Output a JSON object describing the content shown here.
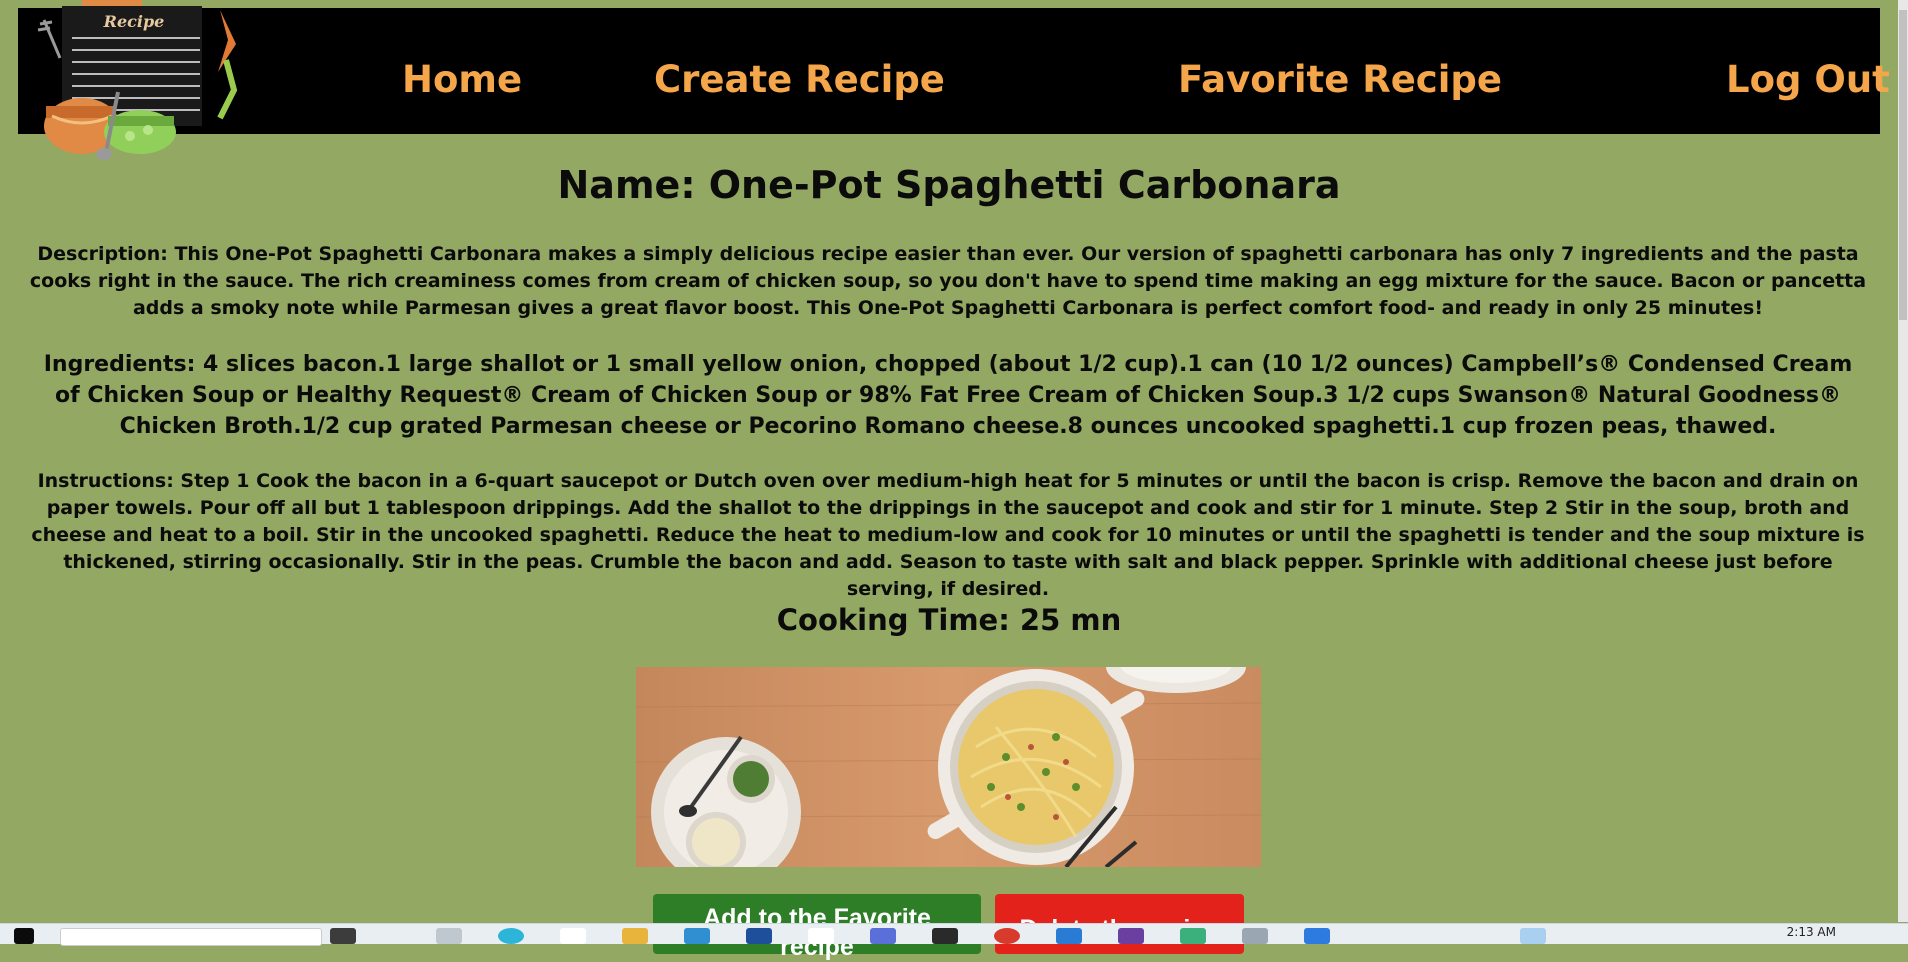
{
  "nav": {
    "logo_text": "Recipe",
    "home": "Home",
    "create": "Create Recipe",
    "favorite": "Favorite Recipe",
    "logout": "Log Out"
  },
  "recipe": {
    "name": "Name: One-Pot Spaghetti Carbonara",
    "description": "Description: This One-Pot Spaghetti Carbonara makes a simply delicious recipe easier than ever. Our version of spaghetti carbonara has only 7 ingredients and the pasta cooks right in the sauce. The rich creaminess comes from cream of chicken soup, so you don't have to spend time making an egg mixture for the sauce. Bacon or pancetta adds a smoky note while Parmesan gives a great flavor boost. This One-Pot Spaghetti Carbonara is perfect comfort food- and ready in only 25 minutes!",
    "ingredients": "Ingredients: 4 slices bacon.1 large shallot or 1 small yellow onion, chopped (about 1/2 cup).1 can (10 1/2 ounces) Campbell’s® Condensed Cream of Chicken Soup or Healthy Request® Cream of Chicken Soup or 98% Fat Free Cream of Chicken Soup.3 1/2 cups Swanson® Natural Goodness® Chicken Broth.1/2 cup grated Parmesan cheese or Pecorino Romano cheese.8 ounces uncooked spaghetti.1 cup frozen peas, thawed.",
    "instructions": "Instructions: Step 1 Cook the bacon in a 6-quart saucepot or Dutch oven over medium-high heat for 5 minutes or until the bacon is crisp. Remove the bacon and drain on paper towels. Pour off all but 1 tablespoon drippings. Add the shallot to the drippings in the saucepot and cook and stir for 1 minute. Step 2 Stir in the soup, broth and cheese and heat to a boil. Stir in the uncooked spaghetti. Reduce the heat to medium-low and cook for 10 minutes or until the spaghetti is tender and the soup mixture is thickened, stirring occasionally. Stir in the peas. Crumble the bacon and add. Season to taste with salt and black pepper. Sprinkle with additional cheese just before serving, if desired.",
    "cooking_time": "Cooking Time: 25 mn"
  },
  "buttons": {
    "add_favorite": "Add to the Favorite recipe",
    "delete": "Delete the recipe"
  },
  "taskbar": {
    "time": "2:13 AM"
  },
  "colors": {
    "background": "#93a862",
    "nav_bg": "#000000",
    "nav_link": "#f5a64a",
    "fav_button": "#2e7d27",
    "delete_button": "#e3221c"
  }
}
